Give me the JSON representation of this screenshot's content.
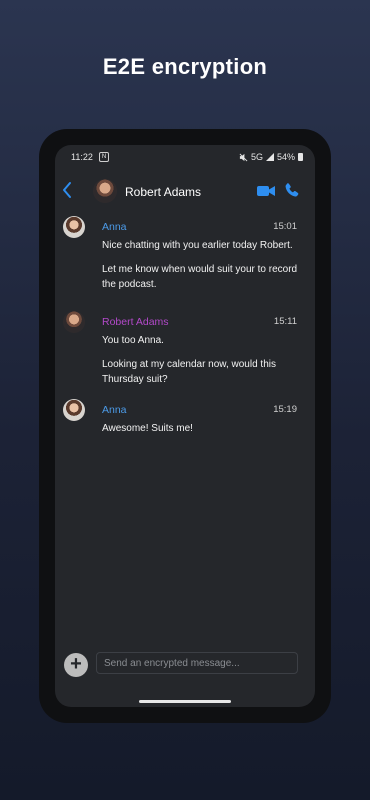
{
  "headline": "E2E encryption",
  "status_bar": {
    "time": "11:22",
    "notif_badge": "N",
    "network": "5G",
    "battery": "54%"
  },
  "header": {
    "contact_name": "Robert Adams"
  },
  "colors": {
    "accent_blue": "#2e8ef0",
    "robert_purple": "#b249c9",
    "anna_blue": "#4c9be8"
  },
  "messages": [
    {
      "sender": "Anna",
      "time": "15:01",
      "lines": [
        "Nice chatting with you earlier today Robert.",
        "Let me know when would suit your to record the podcast."
      ]
    },
    {
      "sender": "Robert Adams",
      "time": "15:11",
      "lines": [
        "You too Anna.",
        "Looking at my calendar now, would this Thursday suit?"
      ]
    },
    {
      "sender": "Anna",
      "time": "15:19",
      "lines": [
        "Awesome! Suits me!"
      ]
    }
  ],
  "composer": {
    "add_label": "+",
    "placeholder": "Send an encrypted message..."
  },
  "icons": [
    "back-arrow-icon",
    "video-call-icon",
    "phone-call-icon",
    "plus-icon",
    "mute-icon",
    "signal-icon",
    "battery-icon"
  ]
}
